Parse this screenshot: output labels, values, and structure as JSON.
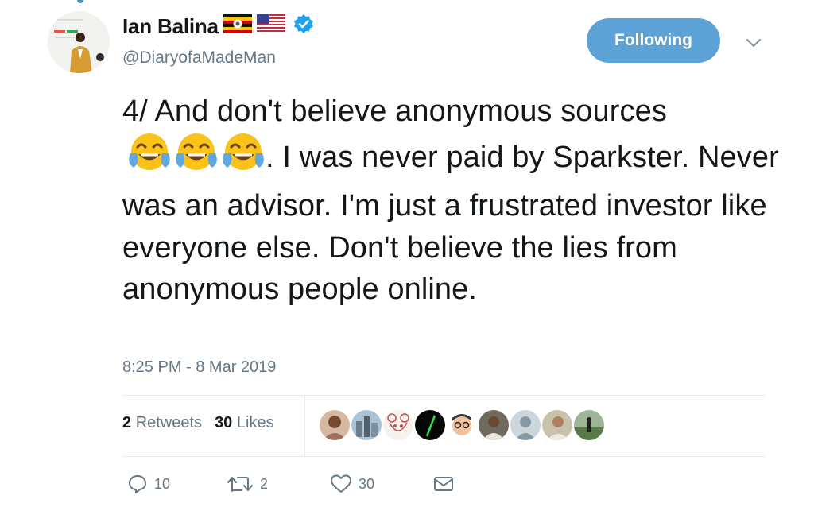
{
  "author": {
    "display_name": "Ian Balina",
    "handle": "@DiaryofaMadeMan",
    "flags": [
      "uganda-flag-icon",
      "us-flag-icon"
    ],
    "verified": true
  },
  "follow_button": {
    "label": "Following"
  },
  "tweet": {
    "text_before_emoji": "4/ And don't believe anonymous sources",
    "emoji": [
      "face-with-tears-of-joy",
      "face-with-tears-of-joy",
      "face-with-tears-of-joy"
    ],
    "text_after_emoji": ". I was never paid by Sparkster. Never was an advisor. I'm just a frustrated investor like everyone else. Don't believe the lies from anonymous people online.",
    "timestamp": "8:25 PM - 8 Mar 2019"
  },
  "stats": {
    "retweets_count": "2",
    "retweets_label": "Retweets",
    "likes_count": "30",
    "likes_label": "Likes"
  },
  "liked_by_avatars": 9,
  "actions": {
    "replies": "10",
    "retweets": "2",
    "likes": "30"
  },
  "colors": {
    "accent": "#5ca2d6",
    "verified": "#1da1f2",
    "secondary_text": "#657786",
    "divider": "#e6ecf0"
  }
}
